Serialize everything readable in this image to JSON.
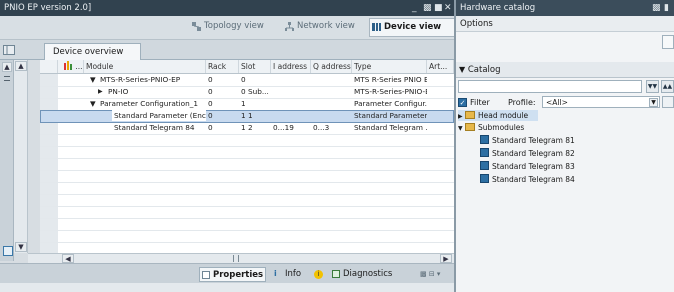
{
  "window": {
    "title": "PNIO EP version 2.0]"
  },
  "views": {
    "topology": "Topology view",
    "network": "Network view",
    "device": "Device view"
  },
  "overview_tab": "Device overview",
  "columns": [
    "...",
    "Module",
    "Rack",
    "Slot",
    "I address",
    "Q address",
    "Type",
    "Art..."
  ],
  "rows": [
    {
      "module": "MTS-R-Series-PNIO-EP",
      "rack": "0",
      "slot": "0",
      "iaddr": "",
      "qaddr": "",
      "type": "MTS R-Series PNIO E..."
    },
    {
      "module": "PN-IO",
      "rack": "0",
      "slot": "0 Sub...",
      "iaddr": "",
      "qaddr": "",
      "type": "MTS-R-Series-PNIO-EP"
    },
    {
      "module": "Parameter Configuration_1",
      "rack": "0",
      "slot": "1",
      "iaddr": "",
      "qaddr": "",
      "type": "Parameter Configur..."
    },
    {
      "module": "Standard Parameter (Enc...",
      "rack": "0",
      "slot": "1 1",
      "iaddr": "",
      "qaddr": "",
      "type": "Standard Parameter."
    },
    {
      "module": "Standard Telegram 84",
      "rack": "0",
      "slot": "1 2",
      "iaddr": "0...19",
      "qaddr": "0...3",
      "type": "Standard Telegram ..."
    }
  ],
  "bottom_tabs": {
    "properties": "Properties",
    "info": "Info",
    "diagnostics": "Diagnostics"
  },
  "catalog": {
    "title": "Hardware catalog",
    "options": "Options",
    "section": "Catalog",
    "filter_label": "Filter",
    "profile_label": "Profile:",
    "profile_value": "<All>",
    "tree": [
      "Head module",
      "Submodules",
      "Standard Telegram 81",
      "Standard Telegram 82",
      "Standard Telegram 83",
      "Standard Telegram 84"
    ]
  }
}
